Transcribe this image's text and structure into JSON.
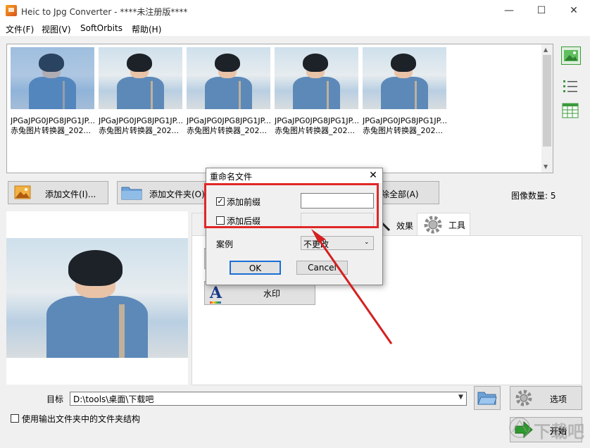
{
  "window": {
    "title": "Heic to Jpg Converter - ****未注册版****"
  },
  "menu": [
    "文件(F)",
    "视图(V)",
    "SoftOrbits",
    "帮助(H)"
  ],
  "thumbnails": [
    {
      "line1": "JPGaJPG0JPG8JPG1JP...",
      "line2": "赤兔图片转换器_202..."
    },
    {
      "line1": "JPGaJPG0JPG8JPG1JP...",
      "line2": "赤兔图片转换器_202..."
    },
    {
      "line1": "JPGaJPG0JPG8JPG1JP...",
      "line2": "赤兔图片转换器_202..."
    },
    {
      "line1": "JPGaJPG0JPG8JPG1JP...",
      "line2": "赤兔图片转换器_202..."
    },
    {
      "line1": "JPGaJPG0JPG8JPG1JP...",
      "line2": "赤兔图片转换器_202..."
    }
  ],
  "toolbar": {
    "add_file": "添加文件(I)...",
    "add_folder": "添加文件夹(O)...",
    "remove_all": "除全部(A)",
    "image_count": "图像数量: 5"
  },
  "tabs": {
    "effects": "效果",
    "tools": "工具"
  },
  "panel": {
    "watermark": "水印"
  },
  "target": {
    "label": "目标",
    "path": "D:\\tools\\桌面\\下载吧"
  },
  "options_button": "选项",
  "start_button": "开始",
  "use_folder_structure": "使用输出文件夹中的文件夹结构",
  "dialog": {
    "title": "重命名文件",
    "add_prefix": "添加前缀",
    "add_suffix": "添加后缀",
    "case_label": "案例",
    "case_value": "不更改",
    "ok": "OK",
    "cancel": "Cancel",
    "prefix_checked": true,
    "suffix_checked": false
  },
  "watermark_text": "下载吧",
  "colors": {
    "highlight": "#e02727",
    "accent_green": "#3a9a3a"
  }
}
